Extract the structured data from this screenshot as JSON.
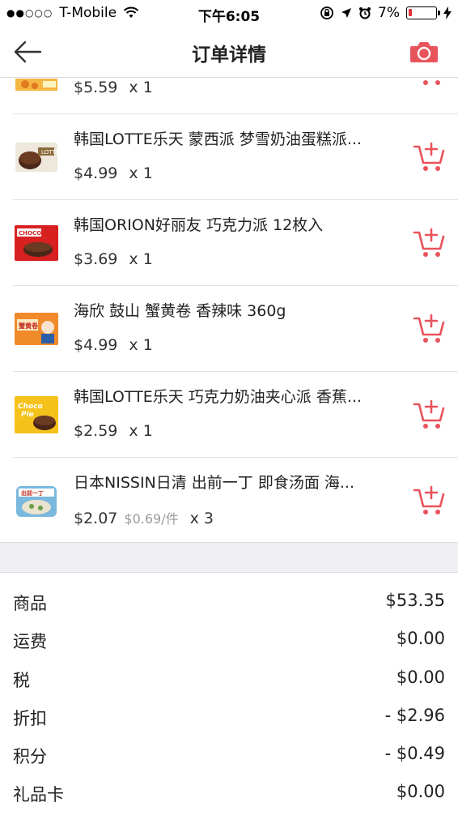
{
  "status_bar": {
    "carrier": "T-Mobile",
    "time": "下午6:05",
    "battery": "7%",
    "battery_level": 0.07
  },
  "nav": {
    "title": "订单详情"
  },
  "colors": {
    "accent": "#e8545c",
    "band": "#efeff4"
  },
  "items": [
    {
      "name": "",
      "price": "$5.59",
      "unit_price": "",
      "qty": "x 1"
    },
    {
      "name": "韩国LOTTE乐天 蒙西派 梦雪奶油蛋糕派...",
      "price": "$4.99",
      "unit_price": "",
      "qty": "x 1"
    },
    {
      "name": "韩国ORION好丽友 巧克力派 12枚入",
      "price": "$3.69",
      "unit_price": "",
      "qty": "x 1"
    },
    {
      "name": "海欣 鼓山 蟹黄卷 香辣味 360g",
      "price": "$4.99",
      "unit_price": "",
      "qty": "x 1"
    },
    {
      "name": "韩国LOTTE乐天 巧克力奶油夹心派 香蕉...",
      "price": "$2.59",
      "unit_price": "",
      "qty": "x 1"
    },
    {
      "name": "日本NISSIN日清 出前一丁 即食汤面 海...",
      "price": "$2.07",
      "unit_price": "$0.69/件",
      "qty": "x 3"
    }
  ],
  "summary": [
    {
      "label": "商品",
      "value": "$53.35"
    },
    {
      "label": "运费",
      "value": "$0.00"
    },
    {
      "label": "税",
      "value": "$0.00"
    },
    {
      "label": "折扣",
      "value": "- $2.96"
    },
    {
      "label": "积分",
      "value": "- $0.49"
    },
    {
      "label": "礼品卡",
      "value": "$0.00"
    }
  ]
}
